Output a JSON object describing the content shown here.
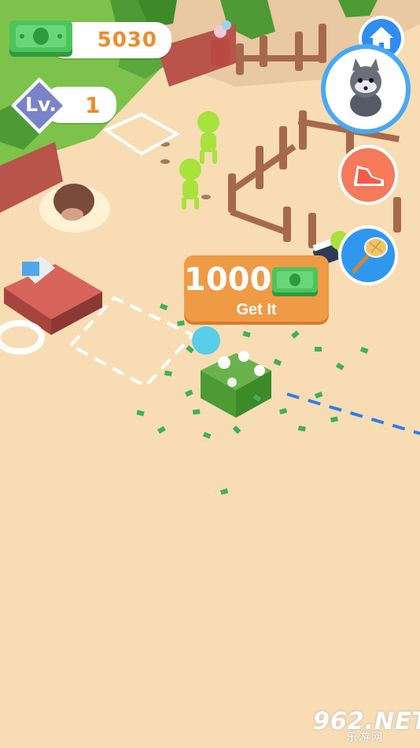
{
  "hud": {
    "money": "5030",
    "level_label": "Lv.",
    "level": "1"
  },
  "reward_panel": {
    "amount": "1000",
    "button_label": "Get It"
  },
  "icons": {
    "home": "home-icon",
    "animal": "raccoon-icon",
    "speed": "sneaker-icon",
    "catch": "butterfly-net-icon",
    "cash": "cash-stack-icon",
    "video": "video-clapper-icon"
  },
  "watermark": {
    "text": "962.NET",
    "subtext": "乐游网"
  },
  "colors": {
    "ground": "#f7dcb4",
    "grass": "#7bc24a",
    "accent_orange": "#ef9a45",
    "money_text": "#f08a2a",
    "blue_button": "#2f8df0",
    "level_badge": "#7a82c8"
  }
}
